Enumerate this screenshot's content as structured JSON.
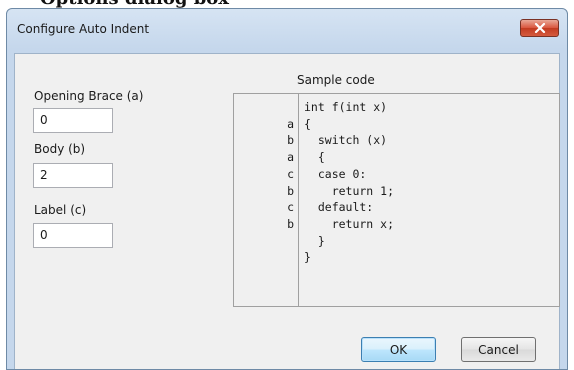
{
  "background": {
    "partial_text": "Options dialog box"
  },
  "dialog": {
    "title": "Configure Auto Indent",
    "close_icon": "close-icon"
  },
  "fields": {
    "opening_brace": {
      "label": "Opening Brace (a)",
      "value": "0"
    },
    "body": {
      "label": "Body (b)",
      "value": "2"
    },
    "label_field": {
      "label": "Label (c)",
      "value": "0"
    }
  },
  "sample": {
    "heading": "Sample code",
    "markers": [
      "",
      "a",
      "b",
      "a",
      "c",
      "b",
      "c",
      "b",
      "",
      ""
    ],
    "lines": [
      "int f(int x)",
      "{",
      "  switch (x)",
      "  {",
      "  case 0:",
      "    return 1;",
      "  default:",
      "    return x;",
      "  }",
      "}"
    ]
  },
  "buttons": {
    "ok": "OK",
    "cancel": "Cancel"
  },
  "colors": {
    "frame": "#c5d7ec",
    "client": "#f0f0f0",
    "close_button": "#c8452b",
    "default_button_border": "#3c7fb1"
  }
}
